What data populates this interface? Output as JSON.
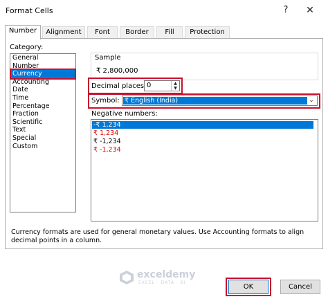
{
  "dialog": {
    "title": "Format Cells",
    "help_glyph": "?",
    "close_glyph": "✕"
  },
  "tabs": [
    {
      "label": "Number",
      "active": true
    },
    {
      "label": "Alignment",
      "active": false
    },
    {
      "label": "Font",
      "active": false
    },
    {
      "label": "Border",
      "active": false
    },
    {
      "label": "Fill",
      "active": false
    },
    {
      "label": "Protection",
      "active": false
    }
  ],
  "category": {
    "label": "Category:",
    "items": [
      "General",
      "Number",
      "Currency",
      "Accounting",
      "Date",
      "Time",
      "Percentage",
      "Fraction",
      "Scientific",
      "Text",
      "Special",
      "Custom"
    ],
    "selected": "Currency"
  },
  "sample": {
    "label": "Sample",
    "value": "₹ 2,800,000"
  },
  "decimal_places": {
    "label": "Decimal places:",
    "value": "0"
  },
  "symbol": {
    "label": "Symbol:",
    "value": "₹ English (India)"
  },
  "negative_numbers": {
    "label": "Negative numbers:",
    "items": [
      {
        "text": "-₹ 1,234",
        "red": false,
        "selected": true
      },
      {
        "text": "₹ 1,234",
        "red": true,
        "selected": false
      },
      {
        "text": "₹ -1,234",
        "red": false,
        "selected": false
      },
      {
        "text": "₹ -1,234",
        "red": true,
        "selected": false
      }
    ]
  },
  "description": "Currency formats are used for general monetary values.  Use Accounting formats to align decimal points in a column.",
  "watermark": {
    "name": "exceldemy",
    "tagline": "EXCEL · DATA · BI"
  },
  "buttons": {
    "ok": "OK",
    "cancel": "Cancel"
  },
  "colors": {
    "selection": "#0078d7",
    "highlight_box": "#c8102e",
    "negative_red": "#e00000"
  }
}
